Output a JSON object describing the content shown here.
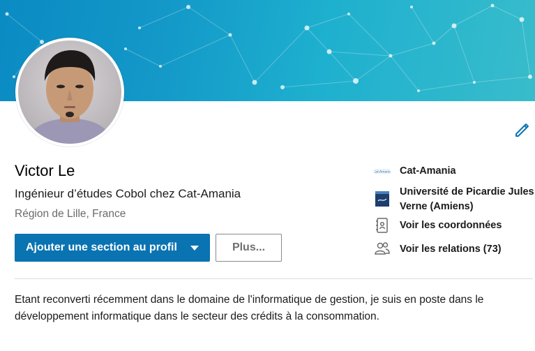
{
  "profile": {
    "name": "Victor Le",
    "headline": "Ingénieur d’études Cobol chez Cat-Amania",
    "location": "Région de Lille, France",
    "avatar_icon": "profile-photo",
    "edit_icon": "pencil-icon"
  },
  "actions": {
    "add_section_label": "Ajouter une section au profil",
    "more_label": "Plus..."
  },
  "sidebar": {
    "items": [
      {
        "label": "Cat-Amania",
        "icon": "company-logo"
      },
      {
        "label": "Université de Picardie Jules Verne (Amiens)",
        "icon": "school-logo"
      },
      {
        "label": "Voir les coordonnées",
        "icon": "contact-card-icon"
      },
      {
        "label": "Voir les relations (73)",
        "icon": "people-icon"
      }
    ]
  },
  "summary": {
    "text": "Etant reconverti récemment dans le domaine de l'informatique de gestion, je suis en poste dans le développement informatique dans le secteur des crédits à la consommation."
  },
  "colors": {
    "primary_button": "#0a73b1",
    "banner_start": "#0a8bc3",
    "banner_end": "#38bccb",
    "edit_icon": "#0a73b1"
  }
}
